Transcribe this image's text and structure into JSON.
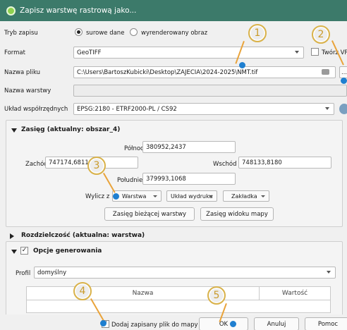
{
  "window": {
    "title": "Zapisz warstwę rastrową jako..."
  },
  "mode": {
    "label": "Tryb zapisu",
    "option_raw": "surowe dane",
    "option_rendered": "wyrenderowany obraz",
    "selected": "surowe dane"
  },
  "format": {
    "label": "Format",
    "value": "GeoTIFF",
    "create_vrt_label": "Twórz VR"
  },
  "filename": {
    "label": "Nazwa pliku",
    "value": "C:\\Users\\BartoszKubicki\\Desktop\\ZAJECIA\\2024-2025\\NMT.tif"
  },
  "layername": {
    "label": "Nazwa warstwy",
    "value": ""
  },
  "crs": {
    "label": "Układ współrzędnych",
    "value": "EPSG:2180 - ETRF2000-PL / CS92"
  },
  "extent": {
    "title": "Zasięg (aktualny: obszar_4)",
    "north_label": "Północ",
    "north": "380952,2437",
    "west_label": "Zachód",
    "west": "747174,6811",
    "east_label": "Wschód",
    "east": "748133,8180",
    "south_label": "Południe",
    "south": "379993,1068",
    "calc_label": "Wylicz z",
    "layer_btn": "Warstwa",
    "layout_btn": "Układ wydruku",
    "bookmark_btn": "Zakładka",
    "current_layer_btn": "Zasięg bieżącej warstwy",
    "map_view_btn": "Zasięg widoku mapy"
  },
  "resolution": {
    "title": "Rozdzielczość (aktualna: warstwa)"
  },
  "options": {
    "title": "Opcje generowania",
    "profile_label": "Profil",
    "profile_value": "domyślny",
    "col_name": "Nazwa",
    "col_value": "Wartość"
  },
  "footer": {
    "add_to_map": "Dodaj zapisany plik do mapy",
    "ok": "OK",
    "cancel": "Anuluj",
    "help": "Pomoc"
  },
  "annotations": {
    "b1": "1",
    "b2": "2",
    "b3": "3",
    "b4": "4",
    "b5": "5"
  },
  "colors": {
    "titlebar": "#3c7a6a",
    "badge_border": "#d9b24a",
    "pointer_dot": "#1f7fd0",
    "pointer_line": "#e9a33a"
  }
}
